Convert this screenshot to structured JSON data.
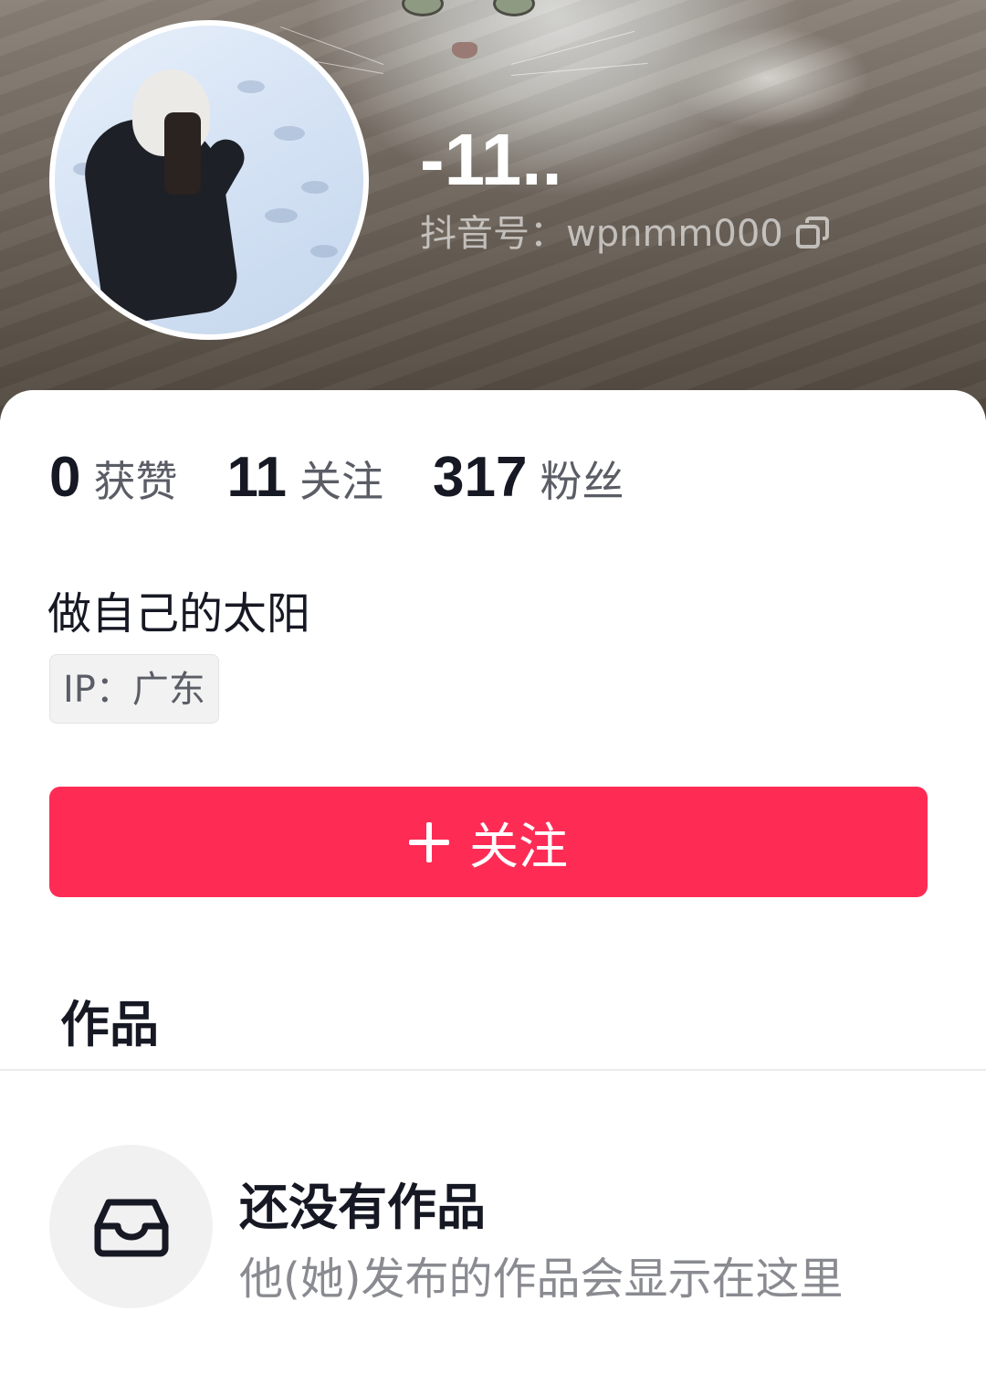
{
  "profile": {
    "name": "-11..",
    "douyin_id": "抖音号：wpnmm000",
    "bio": "做自己的太阳",
    "ip": "IP：广东"
  },
  "stats": [
    {
      "value": "0",
      "label": "获赞"
    },
    {
      "value": "11",
      "label": "关注"
    },
    {
      "value": "317",
      "label": "粉丝"
    }
  ],
  "follow_button": {
    "label": "关注",
    "color": "#fe2c55"
  },
  "tabs": {
    "works": "作品"
  },
  "empty_state": {
    "title": "还没有作品",
    "subtitle": "他(她)发布的作品会显示在这里",
    "icon": "inbox-icon"
  }
}
